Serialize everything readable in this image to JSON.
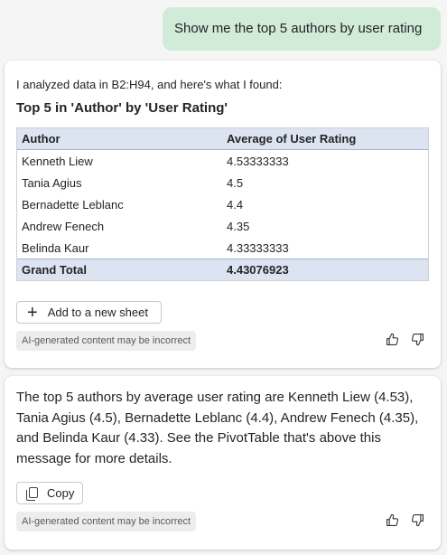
{
  "user_message": "Show me the top 5 authors by user rating",
  "response1": {
    "intro": "I analyzed data in B2:H94, and here's what I found:",
    "title": "Top 5 in 'Author' by 'User Rating'",
    "table": {
      "headers": [
        "Author",
        "Average of User Rating"
      ],
      "rows": [
        [
          "Kenneth Liew",
          "4.53333333"
        ],
        [
          "Tania Agius",
          "4.5"
        ],
        [
          "Bernadette Leblanc",
          "4.4"
        ],
        [
          "Andrew Fenech",
          "4.35"
        ],
        [
          "Belinda Kaur",
          "4.33333333"
        ]
      ],
      "total": [
        "Grand Total",
        "4.43076923"
      ]
    },
    "add_button": "Add to a new sheet",
    "disclaimer": "AI-generated content may be incorrect"
  },
  "response2": {
    "text": "The top 5 authors by average user rating are Kenneth Liew (4.53), Tania Agius (4.5), Bernadette Leblanc (4.4), Andrew Fenech (4.35), and Belinda Kaur (4.33). See the PivotTable that's above this message for more details.",
    "copy_button": "Copy",
    "disclaimer": "AI-generated content may be incorrect"
  },
  "icons": [
    "plus-icon",
    "copy-icon",
    "thumbs-up-icon",
    "thumbs-down-icon"
  ]
}
